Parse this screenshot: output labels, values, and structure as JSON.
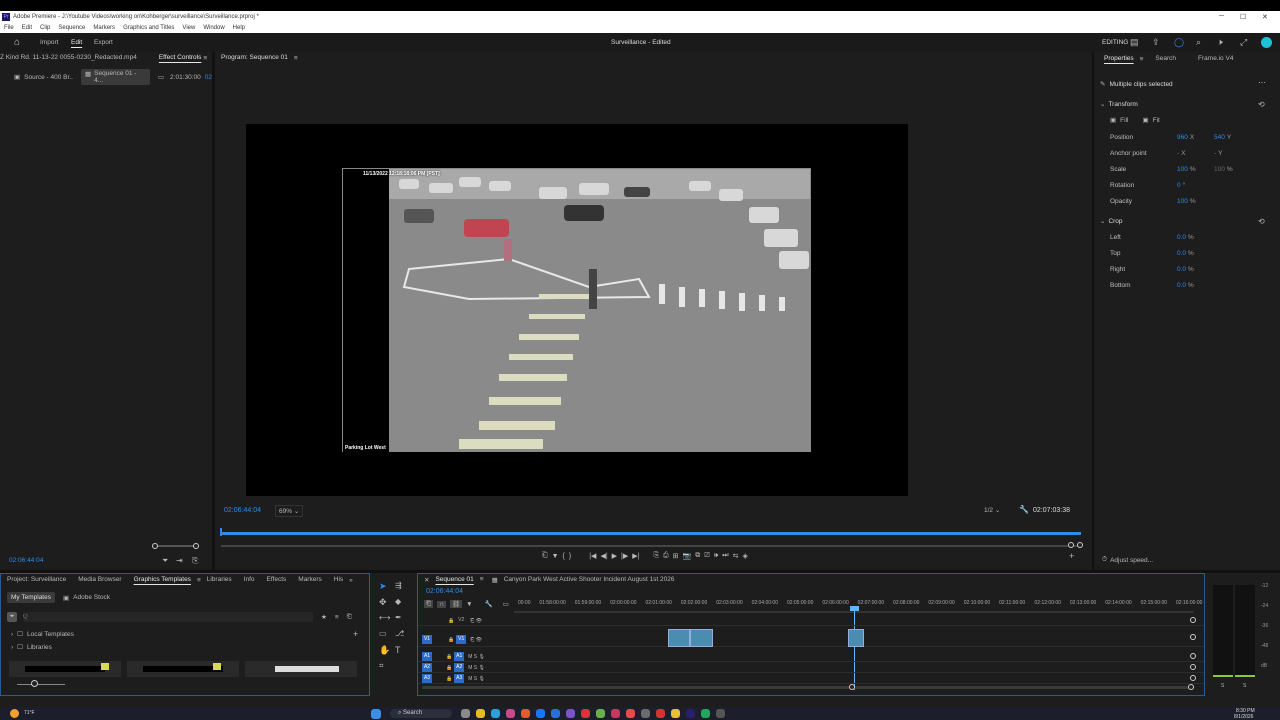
{
  "titlebar": {
    "title": "Adobe Premiere - J:\\Youtube Videos\\working on\\Kohberger\\surveillance\\Surveillance.prproj *",
    "min": "─",
    "max": "☐",
    "close": "✕"
  },
  "menu": [
    "File",
    "Edit",
    "Clip",
    "Sequence",
    "Markers",
    "Graphics and Titles",
    "View",
    "Window",
    "Help"
  ],
  "appbar": {
    "import": "Import",
    "edit": "Edit",
    "export": "Export",
    "project_title": "Surveillance",
    "project_state": "- Edited",
    "editing": "EDITING"
  },
  "source_panel": {
    "clip_name": "Z Kind Rd. 11-13-22 0055-0230_Redacted.mp4",
    "tab_effect": "Effect Controls",
    "tab_aud": "Aud",
    "sub_source": "Source - 400 Br...",
    "sub_seq": "Sequence 01 - 4...",
    "tc_start": "2:01:30:00",
    "tc_end": "02",
    "timecode": "02:06:44:04"
  },
  "program": {
    "title": "Program: Sequence 01",
    "overlay_date": "11/13/2022 12:18:18:06 PM [PST]",
    "overlay_cam": "Parking Lot West",
    "timecode": "02:06:44:04",
    "zoom": "69%",
    "quality": "1/2",
    "duration": "02:07:03:38"
  },
  "properties": {
    "tabs": [
      "Properties",
      "Search",
      "Frame.io V4"
    ],
    "selected": "Multiple clips selected",
    "transform_title": "Transform",
    "fill": "Fill",
    "fit": "Fit",
    "rows": [
      {
        "label": "Position",
        "v1": "960",
        "u1": "X",
        "v2": "540",
        "u2": "Y"
      },
      {
        "label": "Anchor point",
        "v1": "-",
        "u1": "X",
        "v2": "-",
        "u2": "Y"
      },
      {
        "label": "Scale",
        "v1": "100",
        "u1": "%",
        "v2": "100",
        "u2": "%"
      },
      {
        "label": "Rotation",
        "v1": "0",
        "u1": "°",
        "v2": "",
        "u2": ""
      },
      {
        "label": "Opacity",
        "v1": "100",
        "u1": "%",
        "v2": "",
        "u2": ""
      }
    ],
    "crop_title": "Crop",
    "crop": [
      {
        "label": "Left",
        "v": "0.0",
        "u": "%"
      },
      {
        "label": "Top",
        "v": "0.0",
        "u": "%"
      },
      {
        "label": "Right",
        "v": "0.0",
        "u": "%"
      },
      {
        "label": "Bottom",
        "v": "0.0",
        "u": "%"
      }
    ],
    "adjust_speed": "Adjust speed..."
  },
  "bottom_left": {
    "tabs": [
      "Project: Surveillance",
      "Media Browser",
      "Graphics Templates",
      "Libraries",
      "Info",
      "Effects",
      "Markers",
      "His"
    ],
    "my_templates": "My Templates",
    "adobe_stock": "Adobe Stock",
    "search_placeholder": "Q",
    "local_templates": "Local Templates",
    "libraries": "Libraries"
  },
  "timeline": {
    "tab": "Sequence 01",
    "seq_name": "Canyon Park West Active Shooter Incident August 1st 2026",
    "timecode": "02:06:44:04",
    "ruler": [
      "00:00",
      "01:58:00:00",
      "01:59:00:00",
      "02:00:00:00",
      "02:01:00:00",
      "02:02:00:00",
      "02:03:00:00",
      "02:04:00:00",
      "02:05:00:00",
      "02:06:00:00",
      "02:07:00:00",
      "02:08:00:00",
      "02:09:00:00",
      "02:10:00:00",
      "02:11:00:00",
      "02:12:00:00",
      "02:13:00:00",
      "02:14:00:00",
      "02:15:00:00",
      "02:16:00:00"
    ],
    "tracks": [
      {
        "name": "V2",
        "label": ""
      },
      {
        "name": "V1",
        "label": "V1"
      },
      {
        "name": "A1",
        "label": "A1"
      },
      {
        "name": "A2",
        "label": "A2"
      },
      {
        "name": "A3",
        "label": "A3"
      }
    ]
  },
  "meter": {
    "labels": [
      "-12",
      "-24",
      "-36",
      "-48",
      "dB"
    ],
    "left": "S",
    "right": "S"
  },
  "taskbar": {
    "weather": "71°F",
    "search": "Search",
    "time": "8:30 PM",
    "date": "8/1/2026"
  }
}
